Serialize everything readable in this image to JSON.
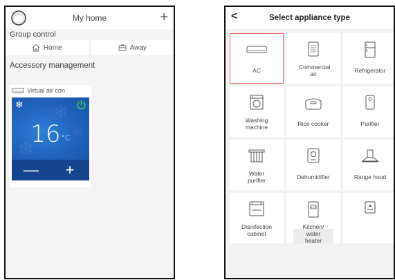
{
  "left_screen": {
    "header": {
      "title": "My home",
      "add_symbol": "+"
    },
    "group_control": {
      "label": "Group control",
      "buttons": [
        {
          "label": "Home",
          "icon": "home-icon"
        },
        {
          "label": "Away",
          "icon": "away-icon"
        }
      ]
    },
    "accessory": {
      "label": "Accessory management",
      "device": {
        "name": "Virtual air con",
        "mode_icon": "snowflake-icon",
        "mode_symbol": "❄",
        "temperature": "16",
        "unit": "°C",
        "minus": "—",
        "plus": "+",
        "power_color": "#35c759",
        "panel_color": "#2468c4"
      }
    }
  },
  "right_screen": {
    "header": {
      "back_symbol": "<",
      "title": "Select appliance type"
    },
    "appliances": [
      {
        "label": "AC",
        "icon": "ac-icon",
        "selected": true
      },
      {
        "label": "Commercial air",
        "icon": "commercial-air-icon"
      },
      {
        "label": "Refrigerator",
        "icon": "refrigerator-icon"
      },
      {
        "label": "Washing machine",
        "icon": "washing-machine-icon"
      },
      {
        "label": "Rice cooker",
        "icon": "rice-cooker-icon"
      },
      {
        "label": "Purifier",
        "icon": "purifier-icon"
      },
      {
        "label": "Water purifier",
        "icon": "water-purifier-icon"
      },
      {
        "label": "Dehumidifier",
        "icon": "dehumidifier-icon"
      },
      {
        "label": "Range hood",
        "icon": "range-hood-icon"
      },
      {
        "label": "Disinfection cabinet",
        "icon": "disinfection-cabinet-icon"
      },
      {
        "label": "Kitchen/ water heater",
        "icon": "water-heater-icon"
      },
      {
        "label": "",
        "icon": "heater-icon"
      }
    ],
    "selected_outline_color": "#e66a6a"
  }
}
